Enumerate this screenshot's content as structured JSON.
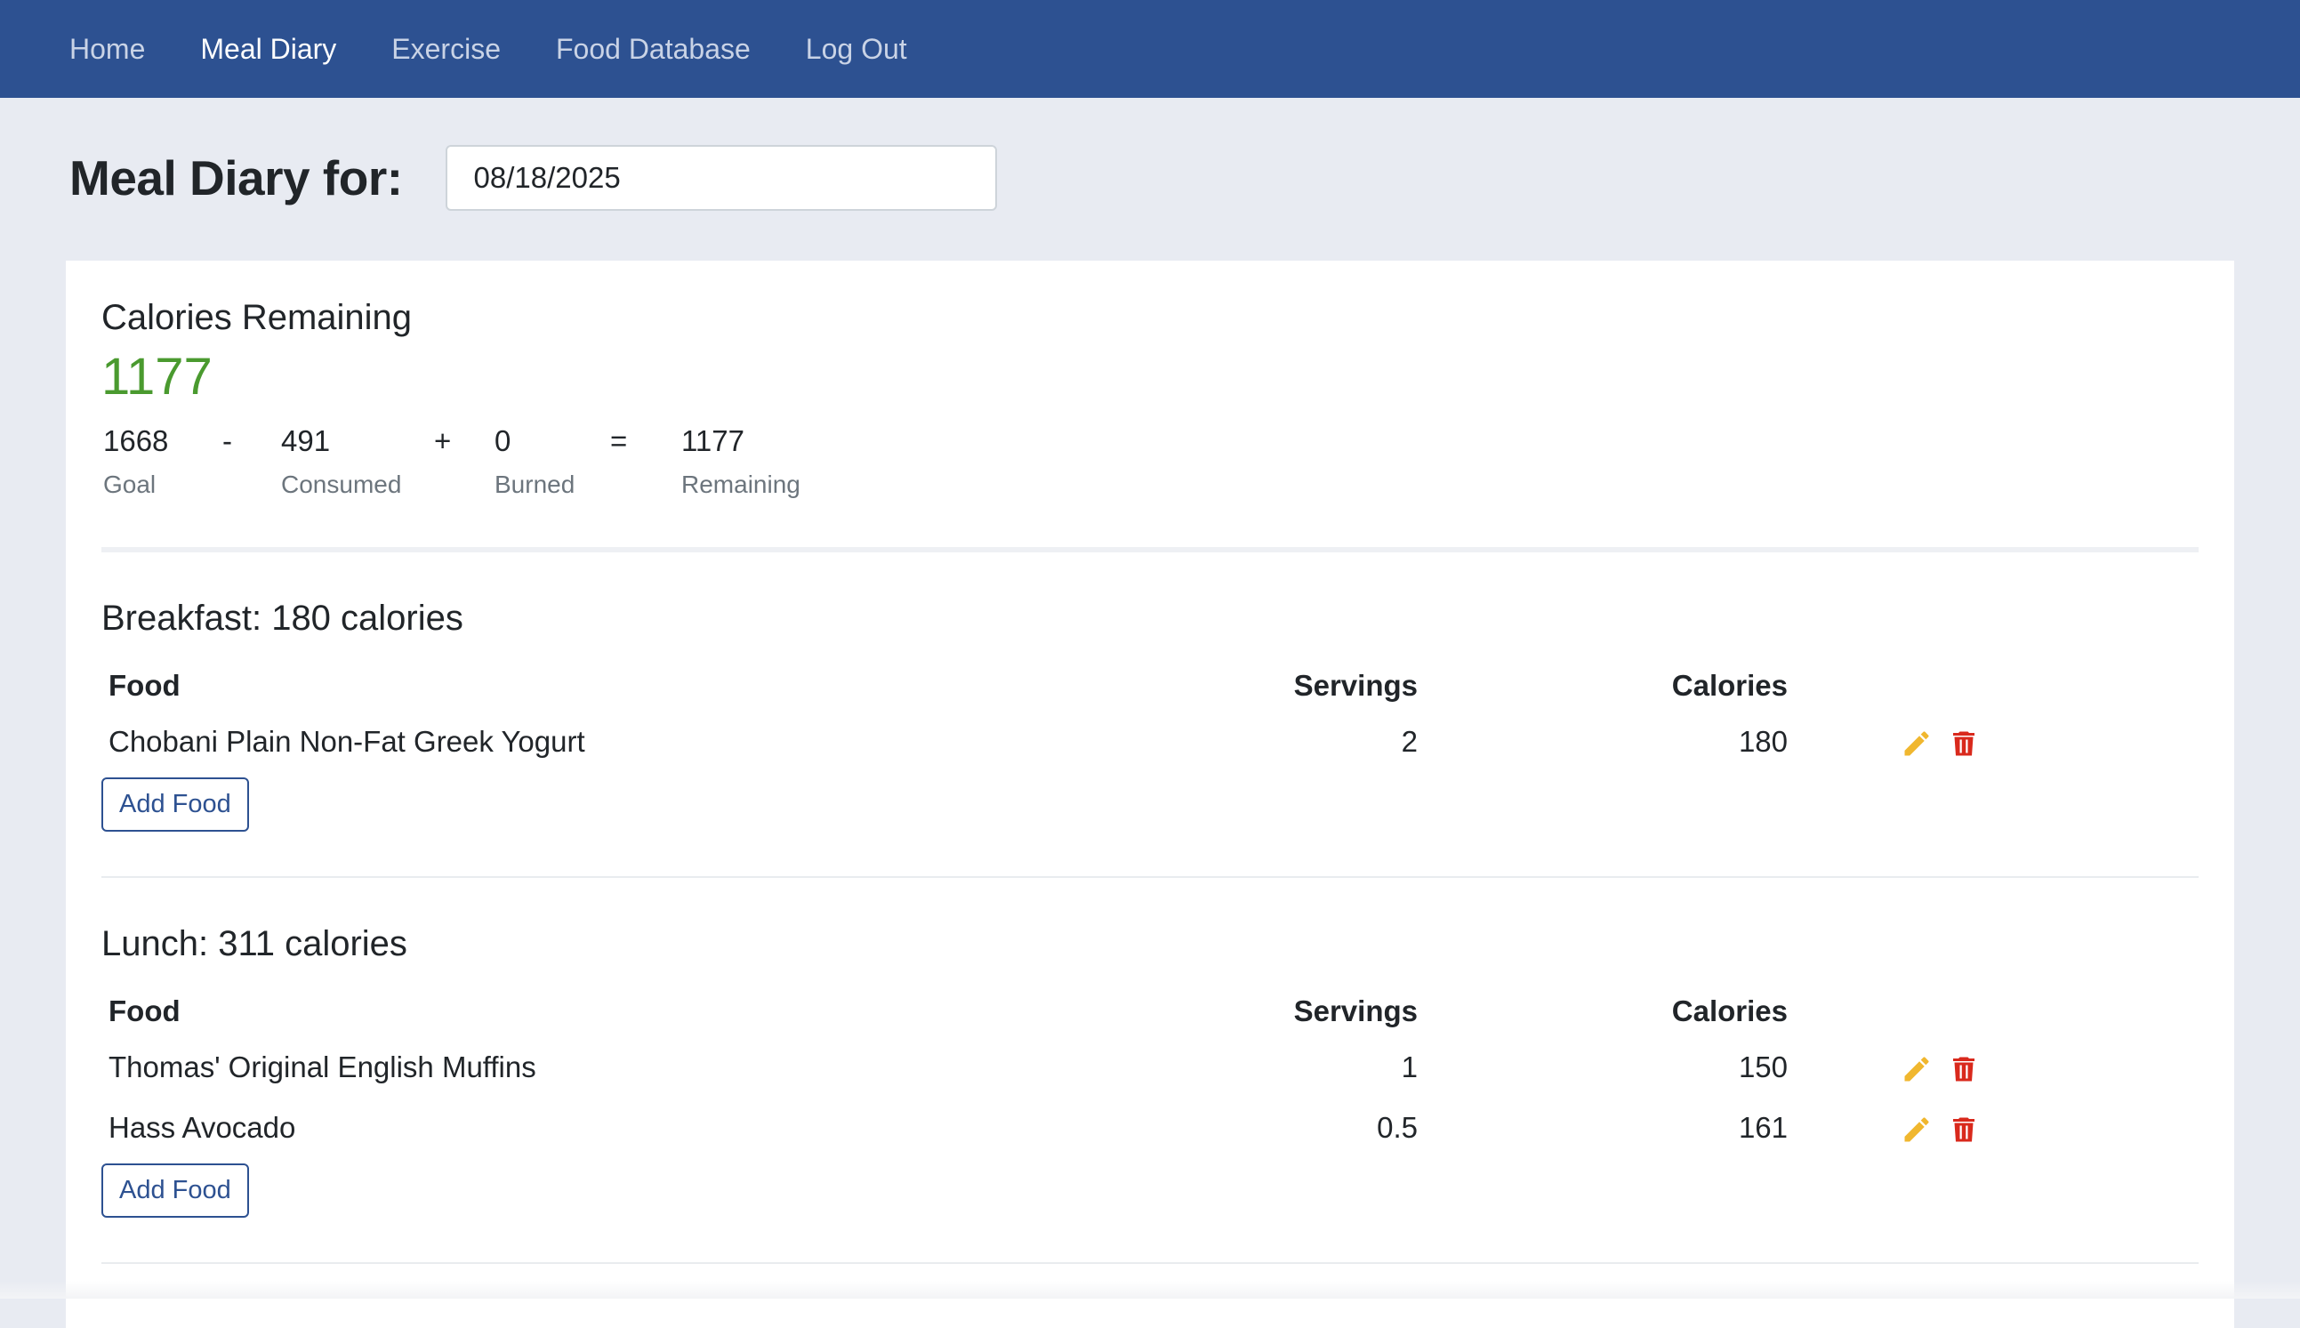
{
  "nav": {
    "items": [
      {
        "label": "Home",
        "active": false
      },
      {
        "label": "Meal Diary",
        "active": true
      },
      {
        "label": "Exercise",
        "active": false
      },
      {
        "label": "Food Database",
        "active": false
      },
      {
        "label": "Log Out",
        "active": false
      }
    ]
  },
  "header": {
    "title": "Meal Diary for:",
    "date_value": "08/18/2025"
  },
  "summary": {
    "title": "Calories Remaining",
    "remaining_big": "1177",
    "goal": {
      "value": "1668",
      "label": "Goal"
    },
    "op1": "-",
    "consumed": {
      "value": "491",
      "label": "Consumed"
    },
    "op2": "+",
    "burned": {
      "value": "0",
      "label": "Burned"
    },
    "op3": "=",
    "remaining": {
      "value": "1177",
      "label": "Remaining"
    }
  },
  "meals": [
    {
      "title": "Breakfast: 180 calories",
      "columns": {
        "food": "Food",
        "servings": "Servings",
        "calories": "Calories"
      },
      "rows": [
        {
          "food": "Chobani Plain Non-Fat Greek Yogurt",
          "servings": "2",
          "calories": "180"
        }
      ],
      "add_label": "Add Food"
    },
    {
      "title": "Lunch: 311 calories",
      "columns": {
        "food": "Food",
        "servings": "Servings",
        "calories": "Calories"
      },
      "rows": [
        {
          "food": "Thomas' Original English Muffins",
          "servings": "1",
          "calories": "150"
        },
        {
          "food": "Hass Avocado",
          "servings": "0.5",
          "calories": "161"
        }
      ],
      "add_label": "Add Food"
    }
  ],
  "colors": {
    "navbar": "#2d5191",
    "remaining_green": "#4a9a2f",
    "edit_icon": "#f0b72f",
    "delete_icon": "#d9291c"
  },
  "icons": {
    "edit": "pencil-icon",
    "delete": "trash-icon"
  }
}
